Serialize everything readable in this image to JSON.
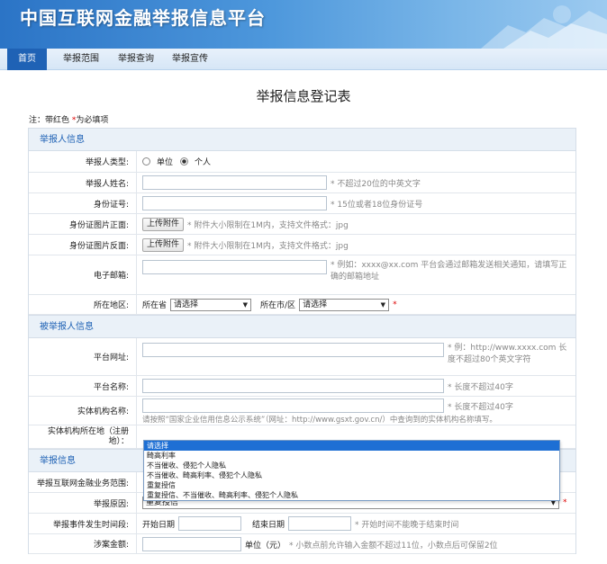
{
  "header": {
    "title": "中国互联网金融举报信息平台"
  },
  "nav": {
    "items": [
      {
        "label": "首页",
        "active": true
      },
      {
        "label": "举报范围"
      },
      {
        "label": "举报查询"
      },
      {
        "label": "举报宣传"
      }
    ]
  },
  "page_title": "举报信息登记表",
  "note": {
    "prefix": "注：带红色",
    "star": " *",
    "suffix": "为必填项"
  },
  "sections": {
    "reporter": "举报人信息",
    "reported": "被举报人信息",
    "report": "举报信息"
  },
  "reporter": {
    "type_label": "举报人类型:",
    "type_options": [
      "单位",
      "个人"
    ],
    "name_label": "举报人姓名:",
    "name_hint": "* 不超过20位的中英文字",
    "id_label": "身份证号:",
    "id_hint": "* 15位或者18位身份证号",
    "id_front_label": "身份证图片正面:",
    "id_back_label": "身份证图片反面:",
    "upload_button": "上传附件",
    "upload_hint": "* 附件大小限制在1M内，支持文件格式：jpg",
    "email_label": "电子邮箱:",
    "email_hint": "*   例如：xxxx@xx.com 平台会通过邮箱发送相关通知，请填写正确的邮箱地址",
    "region_label": "所在地区:",
    "province_label": "所在省",
    "city_label": "所在市/区",
    "select_placeholder": "请选择",
    "region_star": "*"
  },
  "reported": {
    "platform_url_label": "平台网址:",
    "platform_url_hint": "* 例：http://www.xxxx.com 长度不超过80个英文字符",
    "platform_name_label": "平台名称:",
    "platform_name_hint": "* 长度不超过40字",
    "entity_name_label": "实体机构名称:",
    "entity_name_hint": "* 长度不超过40字",
    "entity_name_note": "请按照“国家企业信用信息公示系统”（网址：http://www.gsxt.gov.cn/）中查询到的实体机构名称填写。",
    "entity_addr_label": "实体机构所在地（注册地）："
  },
  "report": {
    "business_label": "举报互联网金融业务范围:",
    "reason_label": "举报原因:",
    "reason_value": "重复授信",
    "reason_star": "*",
    "period_label": "举报事件发生时间段:",
    "start_label": "开始日期",
    "end_label": "结束日期",
    "period_hint": "* 开始时间不能晚于结束时间",
    "amount_label": "涉案金额:",
    "amount_unit": "单位（元）",
    "amount_hint": "* 小数点前允许输入金额不超过11位，小数点后可保留2位"
  },
  "dropdown": {
    "options": [
      {
        "label": "请选择",
        "highlighted": true
      },
      {
        "label": "畸高利率"
      },
      {
        "label": "不当催收、侵犯个人隐私"
      },
      {
        "label": "不当催收、畸高利率、侵犯个人隐私"
      },
      {
        "label": "重复授信"
      },
      {
        "label": "重复授信、不当催收、畸高利率、侵犯个人隐私"
      }
    ]
  }
}
